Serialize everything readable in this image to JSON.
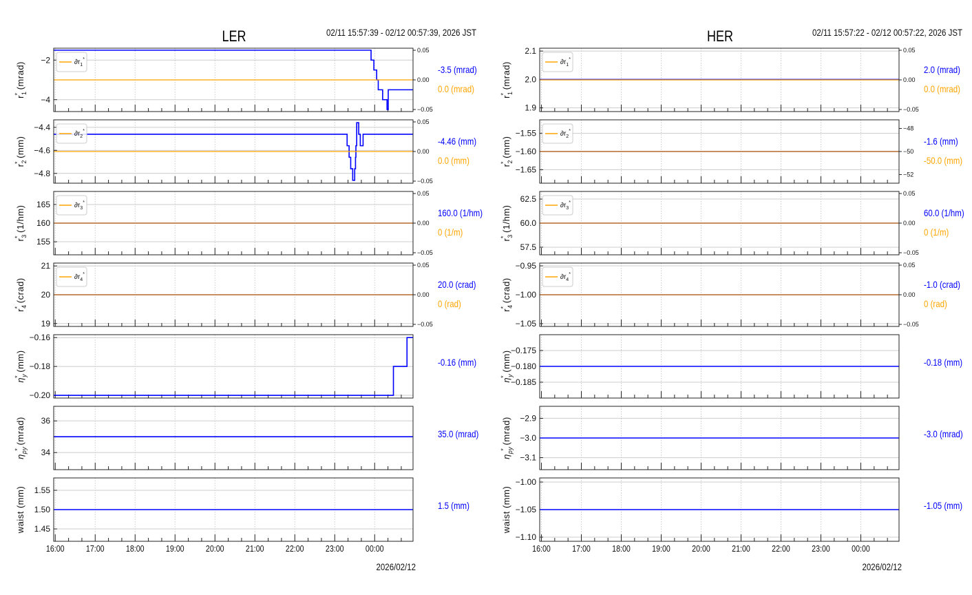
{
  "chart_data": [
    {
      "type": "line",
      "title": "LER",
      "time_range": "02/11 15:57:39 - 02/12 00:57:39, 2026 JST",
      "date_label": "2026/02/12",
      "xlim_hours_from_1600": [
        -0.039,
        8.961
      ],
      "xtick_labels": [
        "16:00",
        "17:00",
        "18:00",
        "19:00",
        "20:00",
        "21:00",
        "22:00",
        "23:00",
        "00:00"
      ],
      "panels": [
        {
          "ylabel": {
            "sym": "r",
            "sub": "1",
            "unit": "(mrad)"
          },
          "ylim": [
            -4.6,
            -1.4
          ],
          "yticks": [
            -2,
            -4
          ],
          "ytick_labels": [
            "−2",
            "−4"
          ],
          "series": [
            [
              -0.04,
              -1.5
            ],
            [
              7.91,
              -2.0
            ],
            [
              7.98,
              -2.5
            ],
            [
              8.05,
              -3.0
            ],
            [
              8.09,
              -3.5
            ],
            [
              8.2,
              -4.0
            ],
            [
              8.31,
              -4.5
            ],
            [
              8.34,
              -3.5
            ],
            [
              8.96,
              -3.5
            ]
          ],
          "legend": "∂r1*",
          "right": {
            "ylim": [
              -0.0535,
              0.0535
            ],
            "yticks": [
              0.05,
              0,
              -0.05
            ],
            "ytick_labels": [
              "0.05",
              "0.00",
              "−0.05"
            ],
            "series": [
              [
                -0.04,
                0
              ],
              [
                8.96,
                0
              ]
            ]
          },
          "value": "-3.5 (mrad)",
          "delta_value": "0.0 (mrad)"
        },
        {
          "ylabel": {
            "sym": "r",
            "sub": "2",
            "unit": "(mm)"
          },
          "ylim": [
            -4.885,
            -4.335
          ],
          "yticks": [
            -4.4,
            -4.6,
            -4.8
          ],
          "ytick_labels": [
            "−4.4",
            "−4.6",
            "−4.8"
          ],
          "series": [
            [
              -0.04,
              -4.46
            ],
            [
              7.31,
              -4.56
            ],
            [
              7.36,
              -4.66
            ],
            [
              7.4,
              -4.76
            ],
            [
              7.45,
              -4.86
            ],
            [
              7.5,
              -4.76
            ],
            [
              7.52,
              -4.66
            ],
            [
              7.53,
              -4.56
            ],
            [
              7.55,
              -4.36
            ],
            [
              7.6,
              -4.46
            ],
            [
              7.64,
              -4.56
            ],
            [
              7.71,
              -4.46
            ],
            [
              8.96,
              -4.46
            ]
          ],
          "legend": "∂r2*",
          "right": {
            "ylim": [
              -0.0535,
              0.0535
            ],
            "yticks": [
              0.05,
              0,
              -0.05
            ],
            "ytick_labels": [
              "0.05",
              "0.00",
              "−0.05"
            ],
            "series": [
              [
                -0.04,
                0
              ],
              [
                8.96,
                0
              ]
            ]
          },
          "value": "-4.46 (mm)",
          "delta_value": "0.0 (mm)"
        },
        {
          "ylabel": {
            "sym": "r",
            "sub": "3",
            "unit": "(1/hm)"
          },
          "ylim": [
            151.5,
            168.5
          ],
          "yticks": [
            165,
            160,
            155
          ],
          "ytick_labels": [
            "165",
            "160",
            "155"
          ],
          "series": [
            [
              -0.04,
              160
            ],
            [
              8.96,
              160
            ]
          ],
          "legend": "∂r3*",
          "right": {
            "ylim": [
              -0.0535,
              0.0535
            ],
            "yticks": [
              0.05,
              0,
              -0.05
            ],
            "ytick_labels": [
              "0.05",
              "0.00",
              "−0.05"
            ],
            "series": [
              [
                -0.04,
                0
              ],
              [
                8.96,
                0
              ]
            ]
          },
          "value": "160.0 (1/hm)",
          "delta_value": "0 (1/m)"
        },
        {
          "ylabel": {
            "sym": "r",
            "sub": "4",
            "unit": "(crad)"
          },
          "ylim": [
            18.9,
            21.1
          ],
          "yticks": [
            21,
            20,
            19
          ],
          "ytick_labels": [
            "21",
            "20",
            "19"
          ],
          "series": [
            [
              -0.04,
              20
            ],
            [
              8.96,
              20
            ]
          ],
          "legend": "∂r4*",
          "right": {
            "ylim": [
              -0.0535,
              0.0535
            ],
            "yticks": [
              0.05,
              0,
              -0.05
            ],
            "ytick_labels": [
              "0.05",
              "0.00",
              "−0.05"
            ],
            "series": [
              [
                -0.04,
                0
              ],
              [
                8.96,
                0
              ]
            ]
          },
          "value": "20.0 (crad)",
          "delta_value": "0 (rad)"
        },
        {
          "ylabel": {
            "sym": "η",
            "sub": "y",
            "unit": "(mm)"
          },
          "ylim": [
            -0.2019,
            -0.158
          ],
          "yticks": [
            -0.16,
            -0.18,
            -0.2
          ],
          "ytick_labels": [
            "−0.16",
            "−0.18",
            "−0.20"
          ],
          "series": [
            [
              -0.04,
              -0.2
            ],
            [
              8.47,
              -0.18
            ],
            [
              8.81,
              -0.16
            ],
            [
              8.96,
              -0.16
            ]
          ],
          "value": "-0.16 (mm)"
        },
        {
          "ylabel": {
            "sym": "η",
            "sub": "py",
            "unit": "(mrad)"
          },
          "ylim": [
            32.92,
            36.92
          ],
          "yticks": [
            36,
            34
          ],
          "ytick_labels": [
            "36",
            "34"
          ],
          "series": [
            [
              -0.04,
              35
            ],
            [
              8.96,
              35
            ]
          ],
          "value": "35.0 (mrad)"
        },
        {
          "ylabel": {
            "sym": "waist",
            "sub": "",
            "unit": "(mm)"
          },
          "ylim": [
            1.418,
            1.582
          ],
          "yticks": [
            1.55,
            1.5,
            1.45
          ],
          "ytick_labels": [
            "1.55",
            "1.50",
            "1.45"
          ],
          "series": [
            [
              -0.04,
              1.5
            ],
            [
              8.96,
              1.5
            ]
          ],
          "value": "1.5 (mm)"
        }
      ]
    },
    {
      "type": "line",
      "title": "HER",
      "time_range": "02/11 15:57:22 - 02/12 00:57:22, 2026 JST",
      "date_label": "2026/02/12",
      "xlim_hours_from_1600": [
        -0.043,
        8.957
      ],
      "xtick_labels": [
        "16:00",
        "17:00",
        "18:00",
        "19:00",
        "20:00",
        "21:00",
        "22:00",
        "23:00",
        "00:00"
      ],
      "panels": [
        {
          "ylabel": {
            "sym": "r",
            "sub": "1",
            "unit": "(mrad)"
          },
          "ylim": [
            1.887,
            2.11
          ],
          "yticks": [
            2.1,
            2.0,
            1.9
          ],
          "ytick_labels": [
            "2.1",
            "2.0",
            "1.9"
          ],
          "series": [
            [
              -0.05,
              2.0
            ],
            [
              8.96,
              2.0
            ]
          ],
          "legend": "∂r1*",
          "right": {
            "ylim": [
              -0.0535,
              0.0535
            ],
            "yticks": [
              0.05,
              0,
              -0.05
            ],
            "ytick_labels": [
              "0.05",
              "0.00",
              "−0.05"
            ],
            "series": [
              [
                -0.05,
                0
              ],
              [
                8.96,
                0
              ]
            ]
          },
          "value": "2.0 (mrad)",
          "delta_value": "0.0 (mrad)"
        },
        {
          "ylabel": {
            "sym": "r",
            "sub": "2",
            "unit": "(mm)"
          },
          "ylim": [
            -1.687,
            -1.513
          ],
          "yticks": [
            -1.55,
            -1.6,
            -1.65
          ],
          "ytick_labels": [
            "−1.55",
            "−1.60",
            "−1.65"
          ],
          "series": [
            [
              -0.05,
              -1.6
            ],
            [
              8.96,
              -1.6
            ]
          ],
          "legend": "∂r2*",
          "right": {
            "ylim": [
              -52.75,
              -47.25
            ],
            "yticks": [
              -48,
              -50,
              -52
            ],
            "ytick_labels": [
              "−48",
              "−50",
              "−52"
            ],
            "series": [
              [
                -0.05,
                -50
              ],
              [
                8.96,
                -50
              ]
            ]
          },
          "value": "-1.6 (mm)",
          "delta_value": "-50.0 (mm)"
        },
        {
          "ylabel": {
            "sym": "r",
            "sub": "3",
            "unit": "(1/hm)"
          },
          "ylim": [
            56.71,
            63.29
          ],
          "yticks": [
            62.5,
            60,
            57.5
          ],
          "ytick_labels": [
            "62.5",
            "60.0",
            "57.5"
          ],
          "series": [
            [
              -0.05,
              60
            ],
            [
              8.96,
              60
            ]
          ],
          "legend": "∂r3*",
          "right": {
            "ylim": [
              -0.0535,
              0.0535
            ],
            "yticks": [
              0.05,
              0,
              -0.05
            ],
            "ytick_labels": [
              "0.05",
              "0.00",
              "−0.05"
            ],
            "series": [
              [
                -0.05,
                0
              ],
              [
                8.96,
                0
              ]
            ]
          },
          "value": "60.0 (1/hm)",
          "delta_value": "0 (1/m)"
        },
        {
          "ylabel": {
            "sym": "r",
            "sub": "4",
            "unit": "(crad)"
          },
          "ylim": [
            -1.0548,
            -0.9452
          ],
          "yticks": [
            -0.95,
            -1.0,
            -1.05
          ],
          "ytick_labels": [
            "−0.95",
            "−1.00",
            "−1.05"
          ],
          "series": [
            [
              -0.05,
              -1.0
            ],
            [
              8.96,
              -1.0
            ]
          ],
          "legend": "∂r4*",
          "right": {
            "ylim": [
              -0.0535,
              0.0535
            ],
            "yticks": [
              0.05,
              0,
              -0.05
            ],
            "ytick_labels": [
              "0.05",
              "0.00",
              "−0.05"
            ],
            "series": [
              [
                -0.05,
                0
              ],
              [
                8.96,
                0
              ]
            ]
          },
          "value": "-1.0 (crad)",
          "delta_value": "0 (rad)"
        },
        {
          "ylabel": {
            "sym": "η",
            "sub": "y",
            "unit": "(mm)"
          },
          "ylim": [
            -0.19,
            -0.17
          ],
          "yticks": [
            -0.175,
            -0.18,
            -0.185
          ],
          "ytick_labels": [
            "−0.175",
            "−0.180",
            "−0.185"
          ],
          "series": [
            [
              -0.05,
              -0.18
            ],
            [
              8.96,
              -0.18
            ]
          ],
          "value": "-0.18 (mm)"
        },
        {
          "ylabel": {
            "sym": "η",
            "sub": "py",
            "unit": "(mrad)"
          },
          "ylim": [
            -3.161,
            -2.839
          ],
          "yticks": [
            -2.9,
            -3.0,
            -3.1
          ],
          "ytick_labels": [
            "−2.9",
            "−3.0",
            "−3.1"
          ],
          "series": [
            [
              -0.05,
              -3.0
            ],
            [
              8.96,
              -3.0
            ]
          ],
          "value": "-3.0 (mrad)"
        },
        {
          "ylabel": {
            "sym": "waist",
            "sub": "",
            "unit": "(mm)"
          },
          "ylim": [
            -1.1075,
            -0.9925
          ],
          "yticks": [
            -1.0,
            -1.05,
            -1.1
          ],
          "ytick_labels": [
            "−1.00",
            "−1.05",
            "−1.10"
          ],
          "series": [
            [
              -0.05,
              -1.05
            ],
            [
              8.96,
              -1.05
            ]
          ],
          "value": "-1.05 (mm)"
        }
      ]
    }
  ],
  "colors": {
    "value": "#0000ff",
    "delta": "#ffa500",
    "grid": "#cccccc",
    "frame": "#222222"
  }
}
